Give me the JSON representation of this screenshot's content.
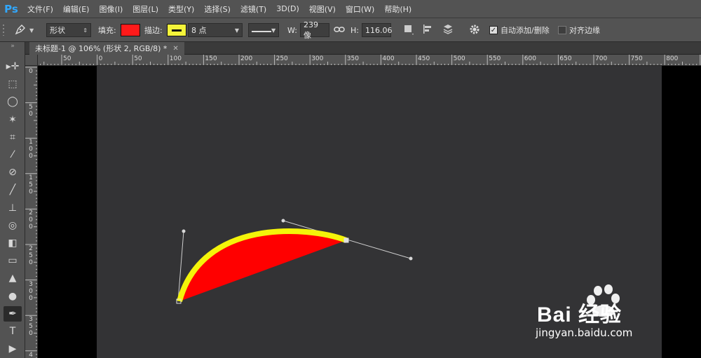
{
  "app": {
    "logo": "Ps"
  },
  "menu": [
    "文件(F)",
    "编辑(E)",
    "图像(I)",
    "图层(L)",
    "类型(Y)",
    "选择(S)",
    "滤镜(T)",
    "3D(D)",
    "视图(V)",
    "窗口(W)",
    "帮助(H)"
  ],
  "options": {
    "mode": "形状",
    "fill_label": "填充:",
    "fill_color": "#ff1a1a",
    "stroke_label": "描边:",
    "stroke_color": "#f4f43a",
    "stroke_width": "8 点",
    "w_label": "W:",
    "w_value": "239 像",
    "h_label": "H:",
    "h_value": "116.06",
    "auto_add_label": "自动添加/删除",
    "auto_add_checked": true,
    "align_edges_label": "对齐边缘",
    "align_edges_checked": false
  },
  "document": {
    "tab_title": "未标题-1 @ 106% (形状 2, RGB/8) *"
  },
  "ruler_h_labels": [
    "50",
    "0",
    "50",
    "100",
    "150",
    "200",
    "250",
    "300",
    "350",
    "400",
    "450",
    "500",
    "550",
    "600",
    "650",
    "700",
    "750",
    "800"
  ],
  "ruler_v_labels": [
    "0",
    "50",
    "100",
    "150",
    "200",
    "250",
    "300",
    "350",
    "400"
  ],
  "tools": [
    {
      "name": "move-tool",
      "icon": "move-icon",
      "glyph": "▸✛"
    },
    {
      "name": "marquee-tool",
      "icon": "marquee-icon",
      "glyph": "⬚"
    },
    {
      "name": "lasso-tool",
      "icon": "lasso-icon",
      "glyph": "◯"
    },
    {
      "name": "magic-wand-tool",
      "icon": "magic-wand-icon",
      "glyph": "✶"
    },
    {
      "name": "crop-tool",
      "icon": "crop-icon",
      "glyph": "⌗"
    },
    {
      "name": "eyedropper-tool",
      "icon": "eyedropper-icon",
      "glyph": "⁄"
    },
    {
      "name": "healing-tool",
      "icon": "bandage-icon",
      "glyph": "⊘"
    },
    {
      "name": "brush-tool",
      "icon": "brush-icon",
      "glyph": "╱"
    },
    {
      "name": "stamp-tool",
      "icon": "stamp-icon",
      "glyph": "⊥"
    },
    {
      "name": "history-brush-tool",
      "icon": "history-brush-icon",
      "glyph": "◎"
    },
    {
      "name": "eraser-tool",
      "icon": "eraser-icon",
      "glyph": "◧"
    },
    {
      "name": "gradient-tool",
      "icon": "gradient-icon",
      "glyph": "▭"
    },
    {
      "name": "blur-tool",
      "icon": "blur-icon",
      "glyph": "▲"
    },
    {
      "name": "dodge-tool",
      "icon": "dodge-icon",
      "glyph": "●"
    },
    {
      "name": "pen-tool",
      "icon": "pen-icon",
      "glyph": "✒"
    },
    {
      "name": "type-tool",
      "icon": "type-icon",
      "glyph": "T"
    },
    {
      "name": "path-select-tool",
      "icon": "path-select-icon",
      "glyph": "▶"
    }
  ],
  "watermark": {
    "brand": "Bai 经验",
    "url": "jingyan.baidu.com"
  }
}
